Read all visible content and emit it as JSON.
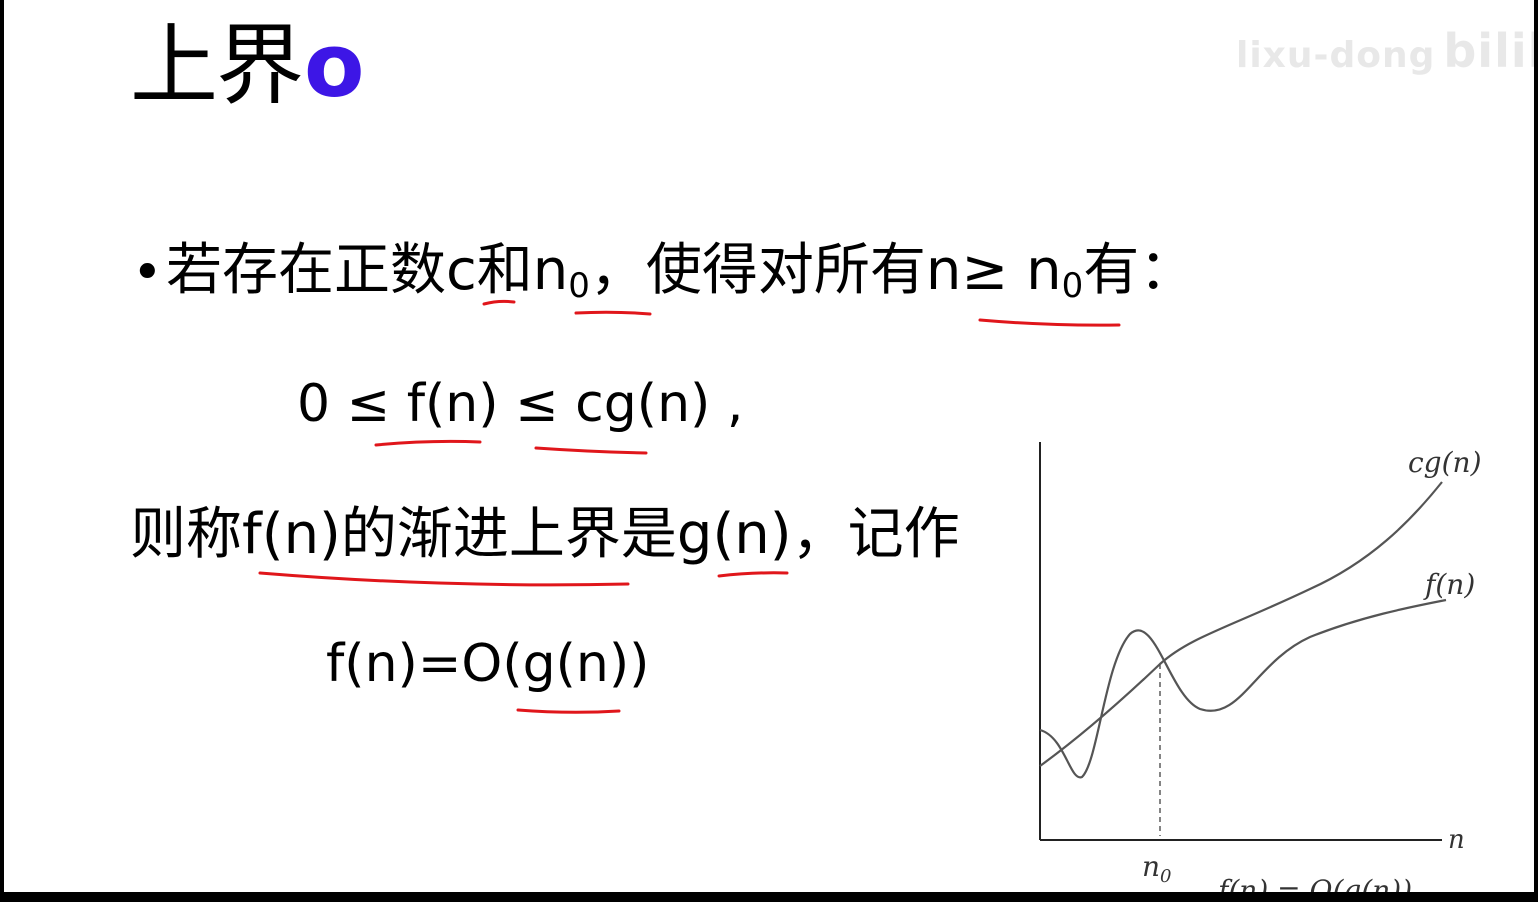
{
  "title": {
    "text": "上界",
    "symbol": "o"
  },
  "watermark": {
    "text": "lixu-dong",
    "brand": "bilibili"
  },
  "definition": {
    "bullet": "•",
    "line1": {
      "pre": "若存在正数c和n",
      "sub": "0",
      "mid": "，使得对所有n≥ n",
      "sub2": "0",
      "post": "有："
    },
    "inequality": "0 ≤ f(n) ≤ cg(n) ,",
    "line3": "则称f(n)的渐进上界是g(n)，记作",
    "formula": "f(n)=O(g(n))"
  },
  "chart_data": {
    "type": "line",
    "series": [
      {
        "name": "cg(n)"
      },
      {
        "name": "f(n)"
      }
    ],
    "xlabel": "n",
    "marker_label": "n0",
    "marker_label_base": "n",
    "marker_label_sub": "0",
    "caption": "f(n) = O(g(n))"
  },
  "colors": {
    "title_symbol": "#3d16e6",
    "underline": "#e0161b"
  }
}
